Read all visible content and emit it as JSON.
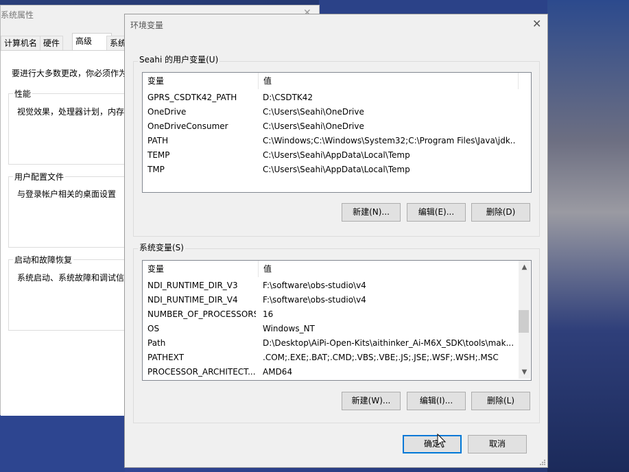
{
  "background": {
    "accent": "#1f2f66"
  },
  "sysprops": {
    "title": "系统属性",
    "tabs": [
      "计算机名",
      "硬件",
      "高级",
      "系统"
    ],
    "notice": "要进行大多数更改，你必须作为",
    "groups": [
      {
        "title": "性能",
        "desc": "视觉效果，处理器计划，内存使"
      },
      {
        "title": "用户配置文件",
        "desc": "与登录帐户相关的桌面设置"
      },
      {
        "title": "启动和故障恢复",
        "desc": "系统启动、系统故障和调试信息"
      }
    ]
  },
  "env": {
    "title": "环境变量",
    "close_icon": "close-icon",
    "user_group_title": "Seahi 的用户变量(U)",
    "user_headers": {
      "var": "变量",
      "val": "值"
    },
    "user_rows": [
      {
        "name": "GPRS_CSDTK42_PATH",
        "value": "D:\\CSDTK42"
      },
      {
        "name": "OneDrive",
        "value": "C:\\Users\\Seahi\\OneDrive"
      },
      {
        "name": "OneDriveConsumer",
        "value": "C:\\Users\\Seahi\\OneDrive"
      },
      {
        "name": "PATH",
        "value": "C:\\Windows;C:\\Windows\\System32;C:\\Program Files\\Java\\jdk..."
      },
      {
        "name": "TEMP",
        "value": "C:\\Users\\Seahi\\AppData\\Local\\Temp"
      },
      {
        "name": "TMP",
        "value": "C:\\Users\\Seahi\\AppData\\Local\\Temp"
      }
    ],
    "user_buttons": {
      "new": "新建(N)...",
      "edit": "编辑(E)...",
      "delete": "删除(D)"
    },
    "sys_group_title": "系统变量(S)",
    "sys_headers": {
      "var": "变量",
      "val": "值"
    },
    "sys_rows": [
      {
        "name": "NDI_RUNTIME_DIR_V3",
        "value": "F:\\software\\obs-studio\\v4"
      },
      {
        "name": "NDI_RUNTIME_DIR_V4",
        "value": "F:\\software\\obs-studio\\v4"
      },
      {
        "name": "NUMBER_OF_PROCESSORS",
        "value": "16"
      },
      {
        "name": "OS",
        "value": "Windows_NT"
      },
      {
        "name": "Path",
        "value": "D:\\Desktop\\AiPi-Open-Kits\\aithinker_Ai-M6X_SDK\\tools\\mak..."
      },
      {
        "name": "PATHEXT",
        "value": ".COM;.EXE;.BAT;.CMD;.VBS;.VBE;.JS;.JSE;.WSF;.WSH;.MSC"
      },
      {
        "name": "PROCESSOR_ARCHITECT...",
        "value": "AMD64"
      }
    ],
    "sys_buttons": {
      "new": "新建(W)...",
      "edit": "编辑(I)...",
      "delete": "删除(L)"
    },
    "ok": "确定",
    "cancel": "取消"
  }
}
